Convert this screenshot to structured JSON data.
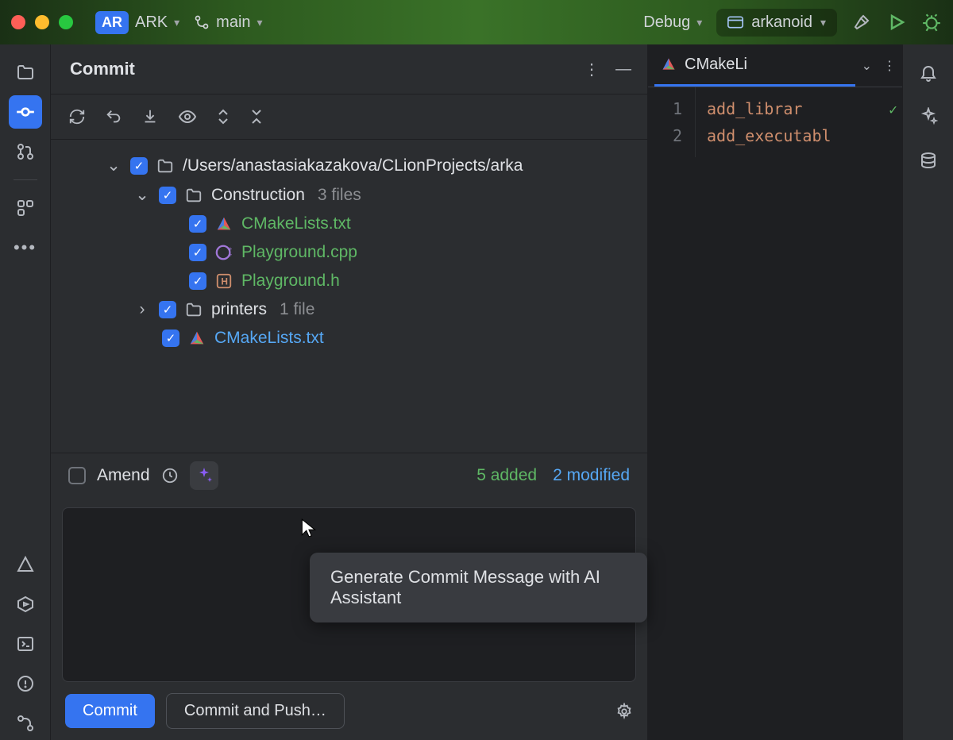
{
  "titlebar": {
    "project_badge": "AR",
    "project_name": "ARK",
    "branch": "main",
    "build_config": "Debug",
    "run_target": "arkanoid"
  },
  "commit": {
    "title": "Commit",
    "root_path": "/Users/anastasiakazakova/CLionProjects/arka",
    "folders": {
      "construction": {
        "name": "Construction",
        "count": "3 files"
      },
      "printers": {
        "name": "printers",
        "count": "1 file"
      }
    },
    "files": {
      "cmake1": "CMakeLists.txt",
      "playground_cpp": "Playground.cpp",
      "playground_h": "Playground.h",
      "cmake_root": "CMakeLists.txt"
    },
    "amend_label": "Amend",
    "stats": {
      "added": "5 added",
      "modified": "2 modified"
    },
    "tooltip": "Generate Commit Message with AI Assistant",
    "commit_btn": "Commit",
    "commit_push_btn": "Commit and Push…"
  },
  "editor": {
    "tab_name": "CMakeLi",
    "gutter": [
      "1",
      "2"
    ],
    "lines": {
      "l1": "add_librar",
      "l2": "add_executabl"
    }
  }
}
